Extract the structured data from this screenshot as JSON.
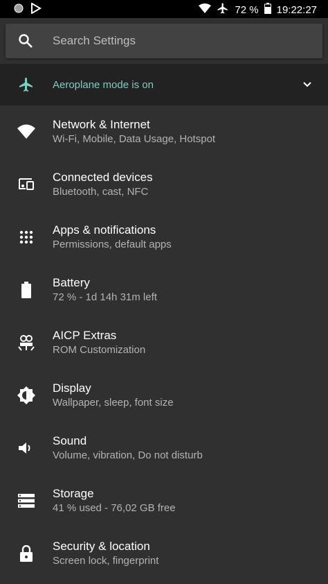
{
  "status_bar": {
    "battery_percent": "72 %",
    "time": "19:22:27"
  },
  "search": {
    "placeholder": "Search Settings"
  },
  "airplane": {
    "label": "Aeroplane mode is on"
  },
  "items": [
    {
      "title": "Network & Internet",
      "subtitle": "Wi-Fi, Mobile, Data Usage, Hotspot",
      "icon": "wifi-icon"
    },
    {
      "title": "Connected devices",
      "subtitle": "Bluetooth, cast, NFC",
      "icon": "devices-icon"
    },
    {
      "title": "Apps & notifications",
      "subtitle": "Permissions, default apps",
      "icon": "apps-grid-icon"
    },
    {
      "title": "Battery",
      "subtitle": "72 % - 1d 14h 31m left",
      "icon": "battery-icon"
    },
    {
      "title": "AICP Extras",
      "subtitle": "ROM Customization",
      "icon": "aicp-icon"
    },
    {
      "title": "Display",
      "subtitle": "Wallpaper, sleep, font size",
      "icon": "brightness-icon"
    },
    {
      "title": "Sound",
      "subtitle": "Volume, vibration, Do not disturb",
      "icon": "volume-icon"
    },
    {
      "title": "Storage",
      "subtitle": "41 % used - 76,02 GB free",
      "icon": "storage-icon"
    },
    {
      "title": "Security & location",
      "subtitle": "Screen lock, fingerprint",
      "icon": "lock-icon"
    }
  ],
  "colors": {
    "background": "#303030",
    "accent": "#80cbc4",
    "subtitle": "#b3b3b3"
  }
}
